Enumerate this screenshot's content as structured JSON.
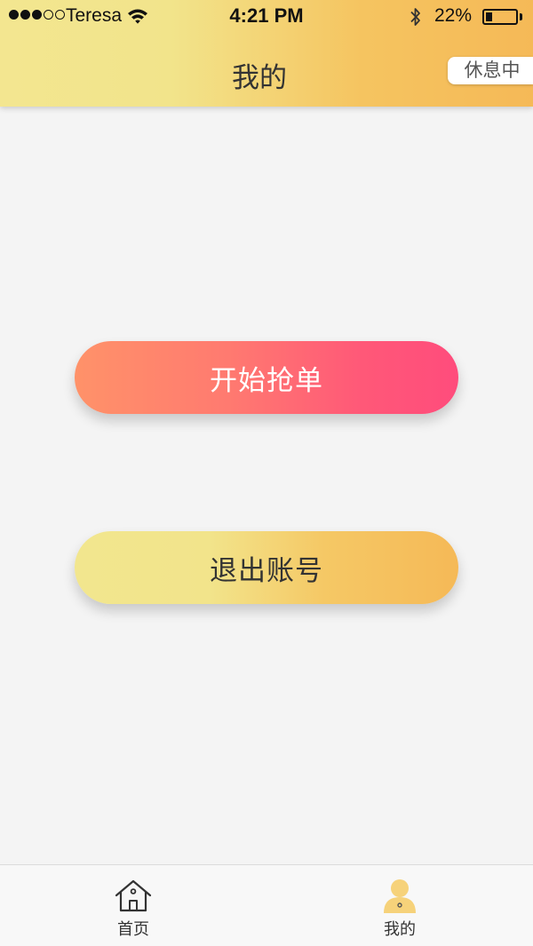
{
  "status_bar": {
    "carrier": "Teresa",
    "time": "4:21 PM",
    "battery": "22%",
    "battery_level": 0.22
  },
  "header": {
    "title": "我的",
    "status_chip": "休息中"
  },
  "actions": {
    "start_label": "开始抢单",
    "logout_label": "退出账号"
  },
  "tab_bar": {
    "items": [
      {
        "label": "首页",
        "icon": "home-icon",
        "active": false
      },
      {
        "label": "我的",
        "icon": "user-icon",
        "active": true
      }
    ]
  },
  "colors": {
    "header_gradient": [
      "#f3e690",
      "#f5b957"
    ],
    "start_gradient": [
      "#ff9269",
      "#ff4c7c"
    ],
    "logout_gradient": [
      "#f2e68e",
      "#f5b957"
    ],
    "active_tab_icon": "#f6d27a"
  }
}
